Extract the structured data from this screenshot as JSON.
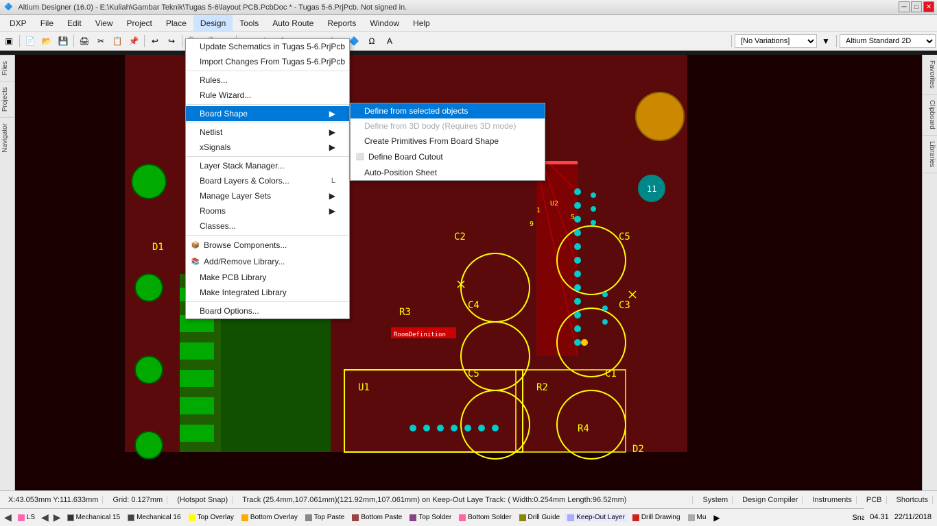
{
  "titlebar": {
    "title": "Altium Designer (16.0) - E:\\Kuliah\\Gambar Teknik\\Tugas 5-6\\layout PCB.PcbDoc * - Tugas 5-6.PrjPcb. Not signed in.",
    "minimize": "─",
    "maximize": "□",
    "close": "✕"
  },
  "menubar": {
    "items": [
      {
        "label": "DXP",
        "id": "dxp"
      },
      {
        "label": "File",
        "id": "file"
      },
      {
        "label": "Edit",
        "id": "edit"
      },
      {
        "label": "View",
        "id": "view"
      },
      {
        "label": "Project",
        "id": "project"
      },
      {
        "label": "Place",
        "id": "place"
      },
      {
        "label": "Design",
        "id": "design",
        "active": true
      },
      {
        "label": "Tools",
        "id": "tools"
      },
      {
        "label": "Auto Route",
        "id": "autoroute"
      },
      {
        "label": "Reports",
        "id": "reports"
      },
      {
        "label": "Window",
        "id": "window"
      },
      {
        "label": "Help",
        "id": "help"
      }
    ]
  },
  "design_menu": {
    "items": [
      {
        "label": "Update Schematics in Tugas 5-6.PrjPcb",
        "id": "update-sch"
      },
      {
        "label": "Import Changes From Tugas 5-6.PrjPcb",
        "id": "import-changes"
      },
      {
        "separator": true
      },
      {
        "label": "Rules...",
        "id": "rules"
      },
      {
        "label": "Rule Wizard...",
        "id": "rule-wizard"
      },
      {
        "separator": true
      },
      {
        "label": "Board Shape",
        "id": "board-shape",
        "arrow": true,
        "highlighted": true
      },
      {
        "separator": false
      },
      {
        "label": "Netlist",
        "id": "netlist",
        "arrow": true
      },
      {
        "label": "xSignals",
        "id": "xsignals",
        "arrow": true
      },
      {
        "separator": true
      },
      {
        "label": "Layer Stack Manager...",
        "id": "layer-stack"
      },
      {
        "label": "Board Layers & Colors...",
        "id": "board-layers",
        "shortcut": "L"
      },
      {
        "label": "Manage Layer Sets",
        "id": "manage-layers",
        "arrow": true
      },
      {
        "label": "Rooms",
        "id": "rooms",
        "arrow": true
      },
      {
        "label": "Classes...",
        "id": "classes"
      },
      {
        "separator": true
      },
      {
        "label": "Browse Components...",
        "id": "browse-components",
        "icon": true
      },
      {
        "label": "Add/Remove Library...",
        "id": "add-remove-library",
        "icon": true
      },
      {
        "label": "Make PCB Library",
        "id": "make-pcb-library"
      },
      {
        "label": "Make Integrated Library",
        "id": "make-integrated-library"
      },
      {
        "separator": true
      },
      {
        "label": "Board Options...",
        "id": "board-options"
      }
    ]
  },
  "board_shape_submenu": {
    "items": [
      {
        "label": "Define from selected objects",
        "id": "define-selected",
        "highlighted": true
      },
      {
        "label": "Define from 3D body (Requires 3D mode)",
        "id": "define-3d",
        "disabled": true
      },
      {
        "label": "Create Primitives From Board Shape",
        "id": "create-primitives"
      },
      {
        "label": "Define Board Cutout",
        "id": "define-cutout",
        "icon": true
      },
      {
        "label": "Auto-Position Sheet",
        "id": "auto-position"
      }
    ]
  },
  "statusbar": {
    "coords": "X:43.053mm Y:111.633mm",
    "grid": "Grid: 0.127mm",
    "snap": "(Hotspot Snap)",
    "track_info": "Track (25.4mm,107.061mm)(121.92mm,107.061mm) on Keep-Out Laye Track: ( Width:0.254mm Length:96.52mm)"
  },
  "bottom_right": {
    "system": "System",
    "design_compiler": "Design Compiler",
    "instruments": "Instruments",
    "pcb": "PCB",
    "shortcuts": "Shortcuts"
  },
  "layers": [
    {
      "name": "LS",
      "color": "#ff69b4",
      "active": true
    },
    {
      "name": "Mechanical 15",
      "color": "#222222"
    },
    {
      "name": "Mechanical 16",
      "color": "#333333"
    },
    {
      "name": "Top Overlay",
      "color": "#ffff00"
    },
    {
      "name": "Bottom Overlay",
      "color": "#ffaa00"
    },
    {
      "name": "Top Paste",
      "color": "#888888"
    },
    {
      "name": "Bottom Paste",
      "color": "#aa4444"
    },
    {
      "name": "Top Solder",
      "color": "#884488"
    },
    {
      "name": "Bottom Solder",
      "color": "#ff66aa"
    },
    {
      "name": "Drill Guide",
      "color": "#888800"
    },
    {
      "name": "Keep-Out Layer",
      "color": "#aaaaff"
    },
    {
      "name": "Drill Drawing",
      "color": "#cc2222"
    },
    {
      "name": "Mu",
      "color": "#aaaaaa"
    }
  ],
  "clock": "04.31",
  "date": "22/11/2018",
  "sidebar_tabs": [
    "Files",
    "Projects",
    "Navigator"
  ],
  "right_tabs": [
    "Favorites",
    "Clipboard",
    "Libraries"
  ]
}
